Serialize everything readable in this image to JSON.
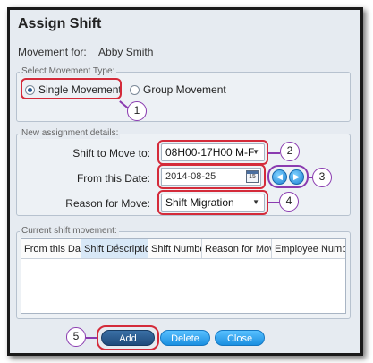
{
  "dialog": {
    "title": "Assign Shift",
    "movement_for_label": "Movement for:",
    "employee_name": "Abby Smith"
  },
  "movement_type": {
    "legend": "Select Movement Type:",
    "options": [
      {
        "label": "Single Movement",
        "selected": true
      },
      {
        "label": "Group Movement",
        "selected": false
      }
    ]
  },
  "assignment": {
    "legend": "New assignment details:",
    "shift_label": "Shift to Move to:",
    "shift_value": "08H00-17H00 M-F",
    "date_label": "From this Date:",
    "date_value": "2014-08-25",
    "calendar_day": "15",
    "reason_label": "Reason for Move:",
    "reason_value": "Shift Migration"
  },
  "current": {
    "legend": "Current shift movement:",
    "columns": [
      "From this Date",
      "Shift Description",
      "Shift Number",
      "Reason for Move",
      "Employee Number"
    ]
  },
  "buttons": {
    "add": "Add",
    "delete": "Delete",
    "close": "Close"
  },
  "callouts": [
    "1",
    "2",
    "3",
    "4",
    "5"
  ],
  "colors": {
    "highlight": "#d42b3a",
    "callout_border": "#8a3bb0",
    "button_blue": "#1b8fe0"
  }
}
